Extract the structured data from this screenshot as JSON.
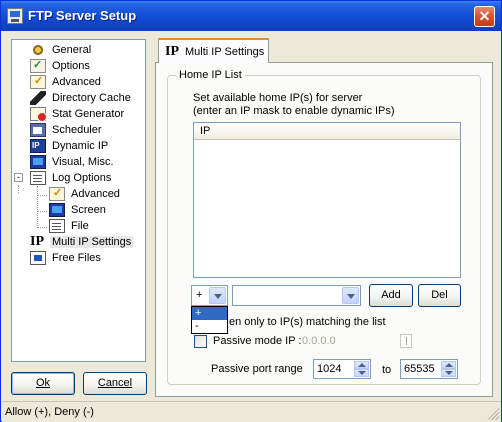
{
  "window": {
    "title": "FTP Server Setup",
    "close_glyph": "✕"
  },
  "tree": {
    "items": [
      {
        "label": "General",
        "icon": "gear-icon"
      },
      {
        "label": "Options",
        "icon": "options-check-icon"
      },
      {
        "label": "Advanced",
        "icon": "advanced-check-icon"
      },
      {
        "label": "Directory Cache",
        "icon": "directory-cache-icon"
      },
      {
        "label": "Stat Generator",
        "icon": "stat-generator-icon"
      },
      {
        "label": "Scheduler",
        "icon": "scheduler-icon"
      },
      {
        "label": "Dynamic IP",
        "icon": "dynamic-ip-icon"
      },
      {
        "label": "Visual, Misc.",
        "icon": "monitor-icon"
      },
      {
        "label": "Log Options",
        "icon": "document-icon",
        "expander": "-"
      },
      {
        "label": "Advanced",
        "icon": "advanced-check-icon"
      },
      {
        "label": "Screen",
        "icon": "screen-icon"
      },
      {
        "label": "File",
        "icon": "file-icon"
      },
      {
        "label": "Multi IP Settings",
        "icon": "ip-icon",
        "selected": true
      },
      {
        "label": "Free Files",
        "icon": "free-files-icon"
      }
    ]
  },
  "buttons": {
    "ok": "Ok",
    "cancel": "Cancel",
    "add": "Add",
    "del": "Del"
  },
  "tab": {
    "icon_text": "IP",
    "label": "Multi IP Settings"
  },
  "group": {
    "title": "Home IP List",
    "description_line1": "Set available home IP(s) for server",
    "description_line2": "(enter an IP mask to enable dynamic IPs)",
    "column_header": "IP"
  },
  "rule_select": {
    "value": "+",
    "options": [
      "+",
      "-"
    ],
    "highlighted": "+"
  },
  "ip_select": {
    "value": ""
  },
  "listen_label": "en only to IP(s) matching the list",
  "passive": {
    "mode_label": "Passive mode IP :",
    "mode_value": "0.0.0.0",
    "range_label": "Passive port range",
    "from": "1024",
    "to_label": "to",
    "to": "65535"
  },
  "status": "Allow (+), Deny (-)"
}
